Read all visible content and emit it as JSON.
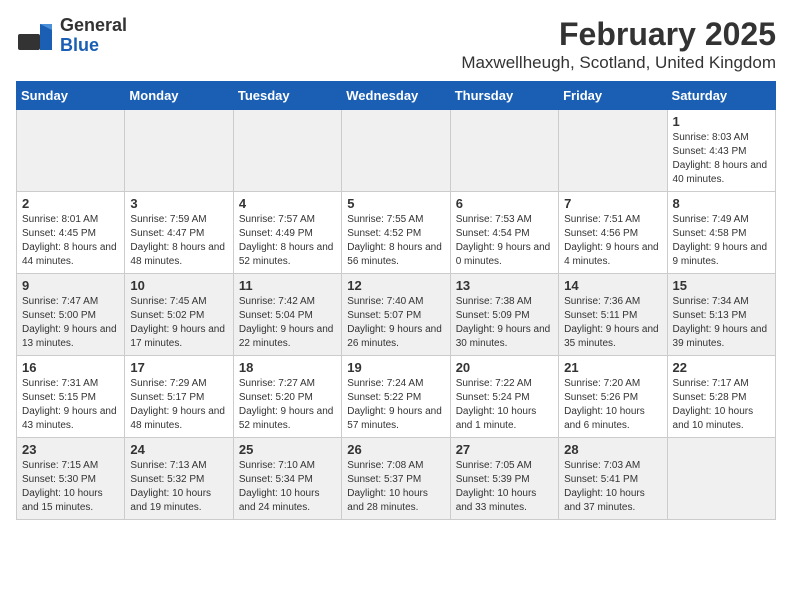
{
  "header": {
    "logo_general": "General",
    "logo_blue": "Blue",
    "title": "February 2025",
    "subtitle": "Maxwellheugh, Scotland, United Kingdom"
  },
  "days_of_week": [
    "Sunday",
    "Monday",
    "Tuesday",
    "Wednesday",
    "Thursday",
    "Friday",
    "Saturday"
  ],
  "weeks": [
    [
      {
        "day": "",
        "info": "",
        "shaded": true
      },
      {
        "day": "",
        "info": "",
        "shaded": true
      },
      {
        "day": "",
        "info": "",
        "shaded": true
      },
      {
        "day": "",
        "info": "",
        "shaded": true
      },
      {
        "day": "",
        "info": "",
        "shaded": true
      },
      {
        "day": "",
        "info": "",
        "shaded": true
      },
      {
        "day": "1",
        "info": "Sunrise: 8:03 AM\nSunset: 4:43 PM\nDaylight: 8 hours and 40 minutes.",
        "shaded": false
      }
    ],
    [
      {
        "day": "2",
        "info": "Sunrise: 8:01 AM\nSunset: 4:45 PM\nDaylight: 8 hours and 44 minutes.",
        "shaded": false
      },
      {
        "day": "3",
        "info": "Sunrise: 7:59 AM\nSunset: 4:47 PM\nDaylight: 8 hours and 48 minutes.",
        "shaded": false
      },
      {
        "day": "4",
        "info": "Sunrise: 7:57 AM\nSunset: 4:49 PM\nDaylight: 8 hours and 52 minutes.",
        "shaded": false
      },
      {
        "day": "5",
        "info": "Sunrise: 7:55 AM\nSunset: 4:52 PM\nDaylight: 8 hours and 56 minutes.",
        "shaded": false
      },
      {
        "day": "6",
        "info": "Sunrise: 7:53 AM\nSunset: 4:54 PM\nDaylight: 9 hours and 0 minutes.",
        "shaded": false
      },
      {
        "day": "7",
        "info": "Sunrise: 7:51 AM\nSunset: 4:56 PM\nDaylight: 9 hours and 4 minutes.",
        "shaded": false
      },
      {
        "day": "8",
        "info": "Sunrise: 7:49 AM\nSunset: 4:58 PM\nDaylight: 9 hours and 9 minutes.",
        "shaded": false
      }
    ],
    [
      {
        "day": "9",
        "info": "Sunrise: 7:47 AM\nSunset: 5:00 PM\nDaylight: 9 hours and 13 minutes.",
        "shaded": true
      },
      {
        "day": "10",
        "info": "Sunrise: 7:45 AM\nSunset: 5:02 PM\nDaylight: 9 hours and 17 minutes.",
        "shaded": true
      },
      {
        "day": "11",
        "info": "Sunrise: 7:42 AM\nSunset: 5:04 PM\nDaylight: 9 hours and 22 minutes.",
        "shaded": true
      },
      {
        "day": "12",
        "info": "Sunrise: 7:40 AM\nSunset: 5:07 PM\nDaylight: 9 hours and 26 minutes.",
        "shaded": true
      },
      {
        "day": "13",
        "info": "Sunrise: 7:38 AM\nSunset: 5:09 PM\nDaylight: 9 hours and 30 minutes.",
        "shaded": true
      },
      {
        "day": "14",
        "info": "Sunrise: 7:36 AM\nSunset: 5:11 PM\nDaylight: 9 hours and 35 minutes.",
        "shaded": true
      },
      {
        "day": "15",
        "info": "Sunrise: 7:34 AM\nSunset: 5:13 PM\nDaylight: 9 hours and 39 minutes.",
        "shaded": true
      }
    ],
    [
      {
        "day": "16",
        "info": "Sunrise: 7:31 AM\nSunset: 5:15 PM\nDaylight: 9 hours and 43 minutes.",
        "shaded": false
      },
      {
        "day": "17",
        "info": "Sunrise: 7:29 AM\nSunset: 5:17 PM\nDaylight: 9 hours and 48 minutes.",
        "shaded": false
      },
      {
        "day": "18",
        "info": "Sunrise: 7:27 AM\nSunset: 5:20 PM\nDaylight: 9 hours and 52 minutes.",
        "shaded": false
      },
      {
        "day": "19",
        "info": "Sunrise: 7:24 AM\nSunset: 5:22 PM\nDaylight: 9 hours and 57 minutes.",
        "shaded": false
      },
      {
        "day": "20",
        "info": "Sunrise: 7:22 AM\nSunset: 5:24 PM\nDaylight: 10 hours and 1 minute.",
        "shaded": false
      },
      {
        "day": "21",
        "info": "Sunrise: 7:20 AM\nSunset: 5:26 PM\nDaylight: 10 hours and 6 minutes.",
        "shaded": false
      },
      {
        "day": "22",
        "info": "Sunrise: 7:17 AM\nSunset: 5:28 PM\nDaylight: 10 hours and 10 minutes.",
        "shaded": false
      }
    ],
    [
      {
        "day": "23",
        "info": "Sunrise: 7:15 AM\nSunset: 5:30 PM\nDaylight: 10 hours and 15 minutes.",
        "shaded": true
      },
      {
        "day": "24",
        "info": "Sunrise: 7:13 AM\nSunset: 5:32 PM\nDaylight: 10 hours and 19 minutes.",
        "shaded": true
      },
      {
        "day": "25",
        "info": "Sunrise: 7:10 AM\nSunset: 5:34 PM\nDaylight: 10 hours and 24 minutes.",
        "shaded": true
      },
      {
        "day": "26",
        "info": "Sunrise: 7:08 AM\nSunset: 5:37 PM\nDaylight: 10 hours and 28 minutes.",
        "shaded": true
      },
      {
        "day": "27",
        "info": "Sunrise: 7:05 AM\nSunset: 5:39 PM\nDaylight: 10 hours and 33 minutes.",
        "shaded": true
      },
      {
        "day": "28",
        "info": "Sunrise: 7:03 AM\nSunset: 5:41 PM\nDaylight: 10 hours and 37 minutes.",
        "shaded": true
      },
      {
        "day": "",
        "info": "",
        "shaded": true
      }
    ]
  ]
}
